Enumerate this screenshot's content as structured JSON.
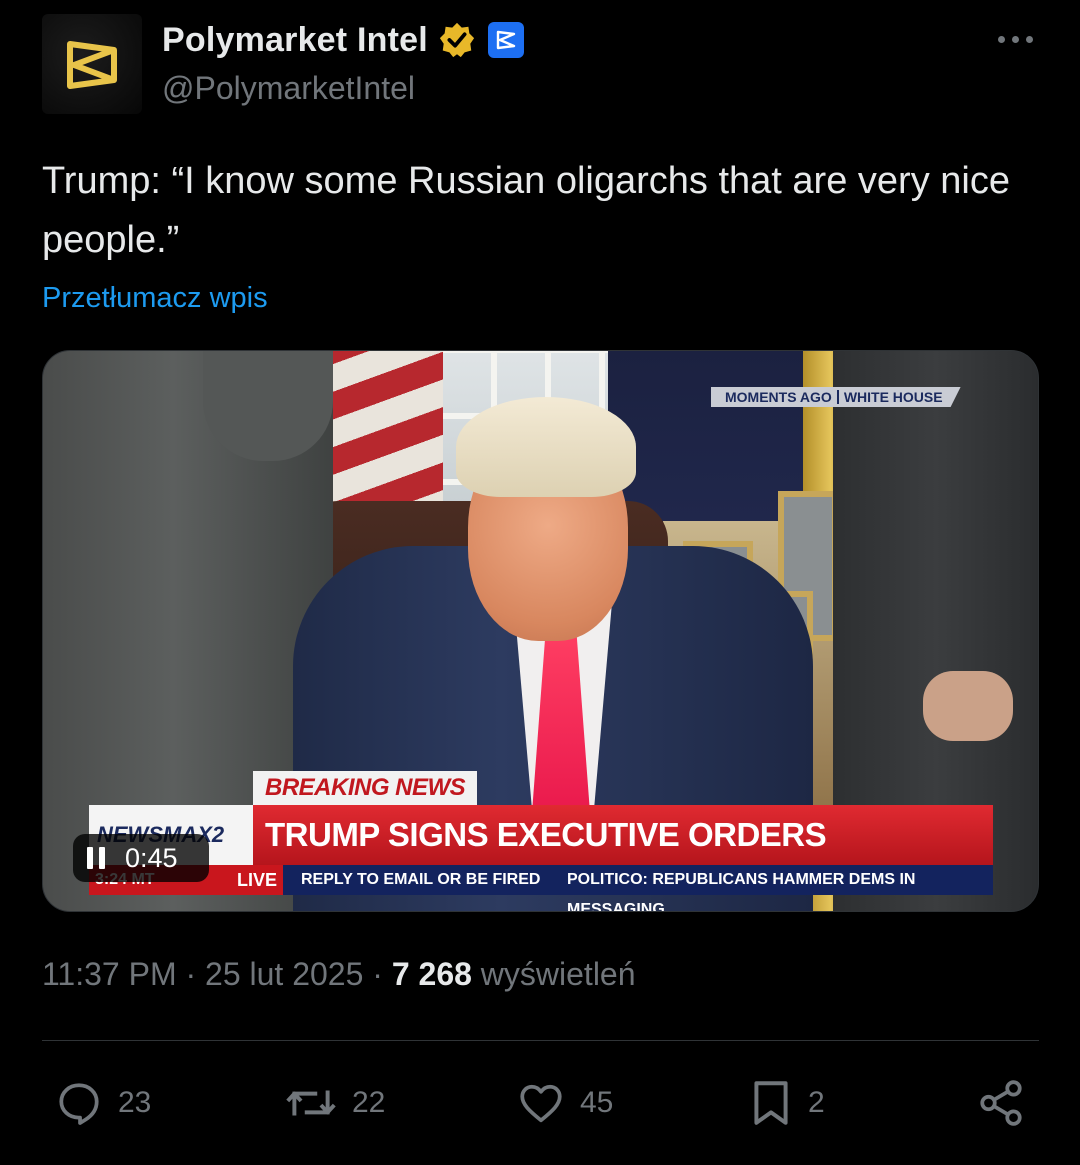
{
  "author": {
    "display_name": "Polymarket Intel",
    "handle": "@PolymarketIntel",
    "verified_badge_color": "#e8b829",
    "affiliate_badge_color": "#1d6ff2"
  },
  "tweet": {
    "text": "Trump: “I know some Russian oligarchs that are very nice people.”",
    "translate_label": "Przetłumacz wpis"
  },
  "media": {
    "type": "video",
    "elapsed": "0:45",
    "overlay": {
      "moments_ago": "MOMENTS AGO",
      "location": "WHITE HOUSE",
      "breaking": "BREAKING NEWS",
      "headline": "TRUMP SIGNS EXECUTIVE ORDERS",
      "channel": "NEWSMAX2",
      "time": "3:24 MT",
      "live": "LIVE",
      "ticker_1": "REPLY TO EMAIL OR BE FIRED",
      "ticker_2": "POLITICO: REPUBLICANS HAMMER DEMS IN MESSAGING"
    }
  },
  "meta": {
    "time": "11:37 PM",
    "separator": "·",
    "date": "25 lut 2025",
    "views": "7 268",
    "views_label": "wyświetleń"
  },
  "actions": {
    "replies": "23",
    "reposts": "22",
    "likes": "45",
    "bookmarks": "2"
  },
  "icons": [
    "verified-icon",
    "affiliate-icon",
    "more-icon",
    "pause-icon",
    "reply-icon",
    "repost-icon",
    "like-icon",
    "bookmark-icon",
    "share-icon"
  ]
}
